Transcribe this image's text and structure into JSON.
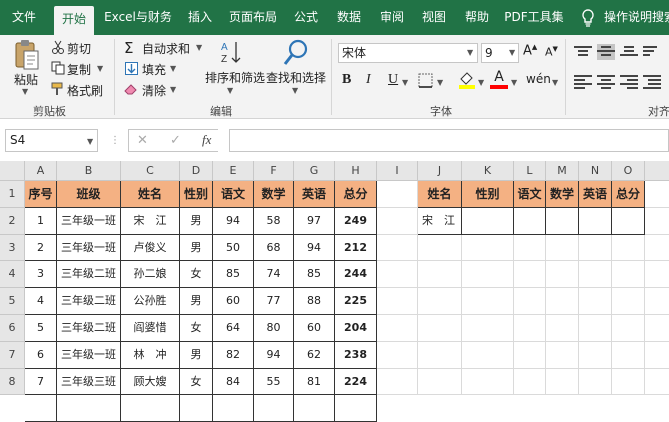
{
  "menu": {
    "tabs": [
      "文件",
      "开始",
      "Excel与财务",
      "插入",
      "页面布局",
      "公式",
      "数据",
      "审阅",
      "视图",
      "帮助",
      "PDF工具集"
    ],
    "active_tab": "开始",
    "tell_me": "操作说明搜索"
  },
  "ribbon": {
    "paste_label": "粘贴",
    "cut_label": "剪切",
    "copy_label": "复制",
    "format_painter_label": "格式刷",
    "clipboard_group": "剪贴板",
    "autosum_label": "自动求和",
    "fill_label": "填充",
    "clear_label": "清除",
    "sort_filter_label": "排序和筛选",
    "find_select_label": "查找和选择",
    "editing_group": "编辑",
    "font_name": "宋体",
    "font_size": "9",
    "font_group": "字体",
    "align_group": "对齐"
  },
  "formula_bar": {
    "name_box": "S4",
    "cancel_symbol": "✕",
    "enter_symbol": "✓",
    "fx_symbol": "fx",
    "formula": ""
  },
  "sheet": {
    "columns": [
      "A",
      "B",
      "C",
      "D",
      "E",
      "F",
      "G",
      "H",
      "I",
      "J",
      "K",
      "L",
      "M",
      "N",
      "O"
    ],
    "rows": [
      "1",
      "2",
      "3",
      "4",
      "5",
      "6",
      "7",
      "8"
    ],
    "headers": [
      "序号",
      "班级",
      "姓名",
      "性别",
      "语文",
      "数学",
      "英语",
      "总分"
    ],
    "data": [
      [
        "1",
        "三年级一班",
        "宋　江",
        "男",
        "94",
        "58",
        "97",
        "249"
      ],
      [
        "2",
        "三年级一班",
        "卢俊义",
        "男",
        "50",
        "68",
        "94",
        "212"
      ],
      [
        "3",
        "三年级二班",
        "孙二娘",
        "女",
        "85",
        "74",
        "85",
        "244"
      ],
      [
        "4",
        "三年级二班",
        "公孙胜",
        "男",
        "60",
        "77",
        "88",
        "225"
      ],
      [
        "5",
        "三年级二班",
        "阎婆惜",
        "女",
        "64",
        "80",
        "60",
        "204"
      ],
      [
        "6",
        "三年级一班",
        "林　冲",
        "男",
        "82",
        "94",
        "62",
        "238"
      ],
      [
        "7",
        "三年级三班",
        "顾大嫂",
        "女",
        "84",
        "55",
        "81",
        "224"
      ]
    ],
    "lookup_headers": [
      "姓名",
      "性别",
      "语文",
      "数学",
      "英语",
      "总分"
    ],
    "lookup_row": [
      "宋　江",
      "",
      "",
      "",
      "",
      ""
    ]
  },
  "colors": {
    "title_bar": "#217346",
    "header_fill": "#f4b183",
    "ribbon_bg": "#f3f3f3"
  }
}
